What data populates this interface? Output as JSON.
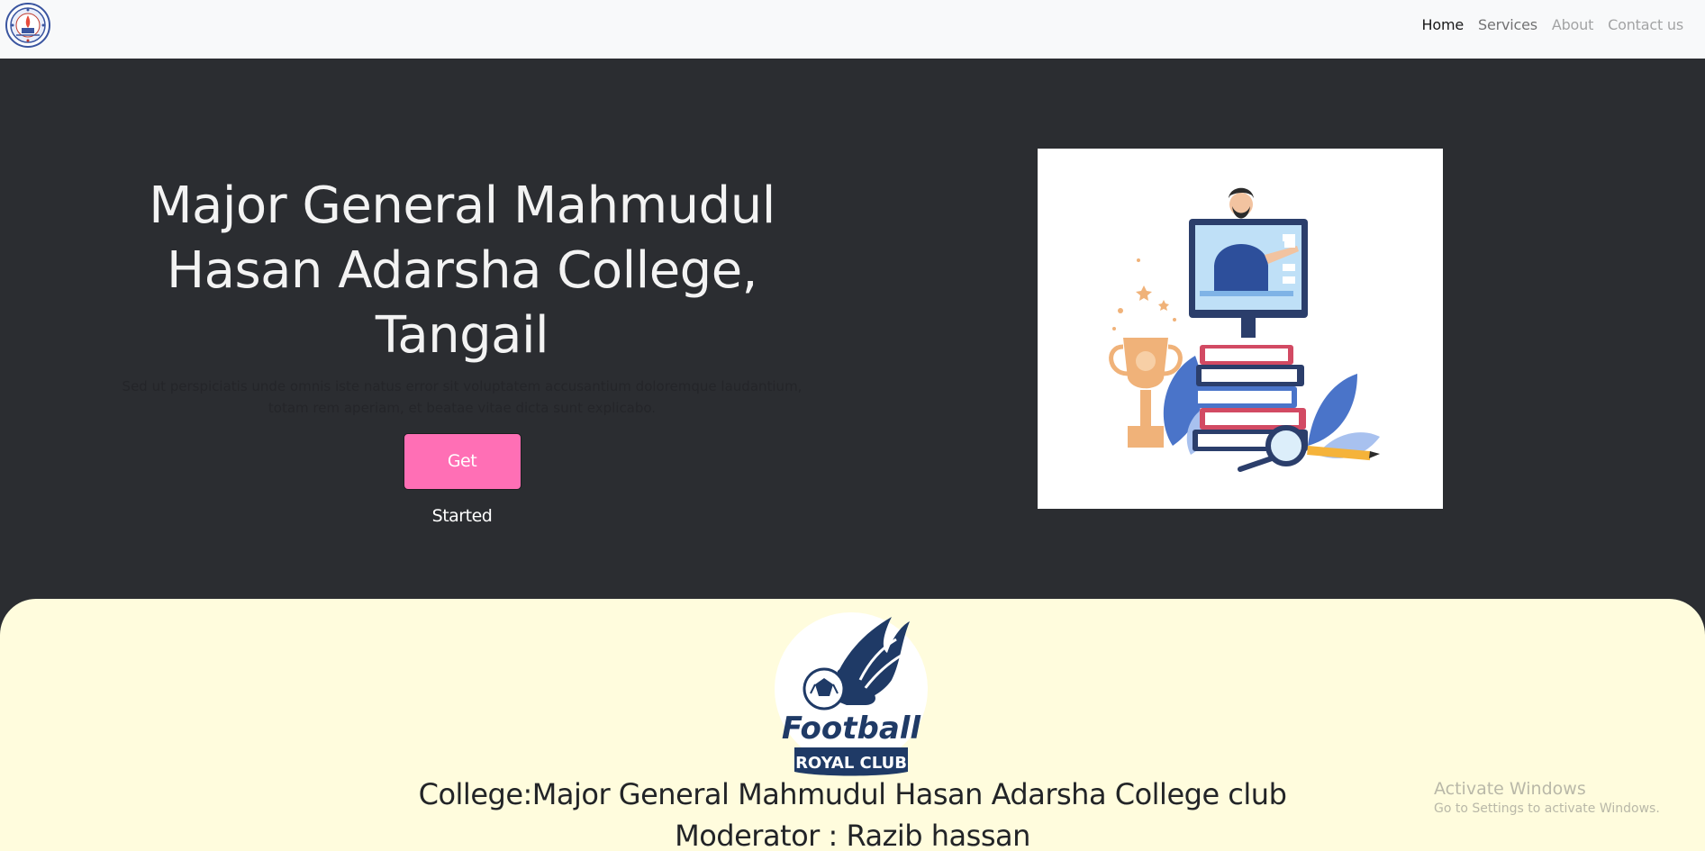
{
  "navbar": {
    "logo_icon": "college-emblem-icon",
    "links": [
      {
        "label": "Home"
      },
      {
        "label": "Services"
      },
      {
        "label": "About"
      },
      {
        "label": "Contact us"
      }
    ]
  },
  "hero": {
    "title": "Major General Mahmudul Hasan Adarsha College, Tangail",
    "description": "Sed ut perspiciatis unde omnis iste natus error sit voluptatem accusantium doloremque laudantium, totam rem aperiam, et beatae vitae dicta sunt explicabo.",
    "cta_label": "Get Started",
    "image_icon": "teacher-books-trophy-illustration"
  },
  "club": {
    "logo_text_1": "Football",
    "logo_text_2": "ROYAL CLUB",
    "college_line": "College:Major General Mahmudul Hasan Adarsha College club",
    "moderator_line": "Moderator : Razib hassan"
  },
  "watermark": {
    "line1": "Activate Windows",
    "line2": "Go to Settings to activate Windows."
  },
  "colors": {
    "navbar_bg": "#f8f9fa",
    "hero_bg": "#2b2d31",
    "cta_bg": "#ff6fb5",
    "club_bg": "#fffcdd",
    "club_logo_navy": "#1f3a66"
  }
}
